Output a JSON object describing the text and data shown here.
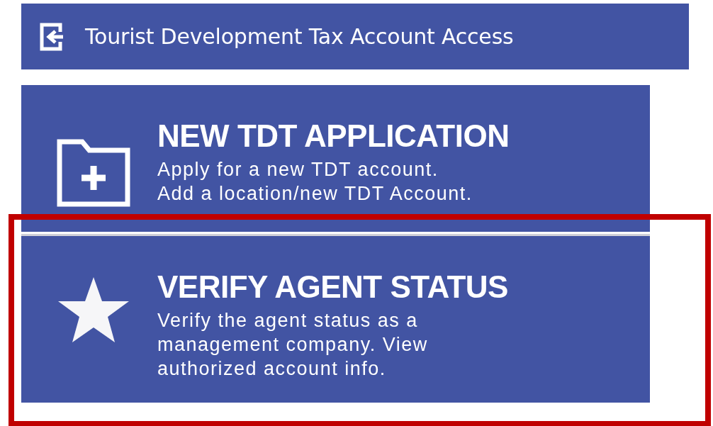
{
  "header": {
    "title": "Tourist Development Tax Account Access"
  },
  "cards": [
    {
      "kind": "folder",
      "title": "NEW TDT APPLICATION",
      "lines": [
        "Apply for a new TDT account.",
        "Add a location/new TDT Account."
      ],
      "highlighted": false
    },
    {
      "kind": "star",
      "title": "VERIFY AGENT STATUS",
      "lines": [
        "Verify the agent status as a",
        "management company. View",
        "authorized account info."
      ],
      "highlighted": true
    }
  ]
}
